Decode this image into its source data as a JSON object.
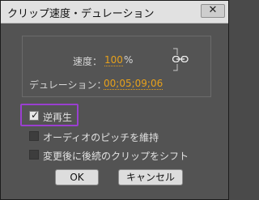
{
  "window": {
    "title": "クリップ速度・デュレーション",
    "close_symbol": "✕"
  },
  "speed": {
    "label": "速度：",
    "value": "100",
    "unit": "%"
  },
  "duration": {
    "label": "デュレーション：",
    "value": "00;05;09;06"
  },
  "link_icon": "chain-link-icon",
  "options": [
    {
      "label": "逆再生",
      "checked": true
    },
    {
      "label": "オーディオのピッチを維持",
      "checked": false
    },
    {
      "label": "変更後に後続のクリップをシフト",
      "checked": false
    }
  ],
  "buttons": {
    "ok": "OK",
    "cancel": "キャンセル"
  },
  "colors": {
    "accent_value": "#e8a11b",
    "focus": "#9a3fd0"
  }
}
